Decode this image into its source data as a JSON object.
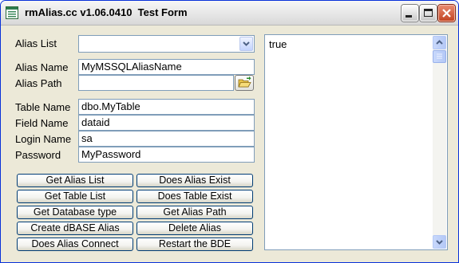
{
  "window": {
    "title": "rmAlias.cc v1.06.0410  Test Form"
  },
  "fields": {
    "alias_list": {
      "label": "Alias List",
      "value": ""
    },
    "alias_name": {
      "label": "Alias Name",
      "value": "MyMSSQLAliasName"
    },
    "alias_path": {
      "label": "Alias Path",
      "value": ""
    },
    "table_name": {
      "label": "Table Name",
      "value": "dbo.MyTable"
    },
    "field_name": {
      "label": "Field Name",
      "value": "dataid"
    },
    "login_name": {
      "label": "Login Name",
      "value": "sa"
    },
    "password": {
      "label": "Password",
      "value": "MyPassword"
    }
  },
  "buttons": {
    "get_alias_list": "Get Alias List",
    "does_alias_exist": "Does Alias Exist",
    "get_table_list": "Get Table List",
    "does_table_exist": "Does Table Exist",
    "get_database_type": "Get Database type",
    "get_alias_path": "Get Alias Path",
    "create_dbase_alias": "Create dBASE Alias",
    "delete_alias": "Delete Alias",
    "does_alias_connect": "Does Alias Connect",
    "restart_bde": "Restart the BDE"
  },
  "output": {
    "text": "true"
  },
  "icons": {
    "app": "form-icon",
    "minimize": "minimize-icon",
    "maximize": "maximize-icon",
    "close": "close-icon",
    "dropdown": "chevron-down-icon",
    "browse": "open-folder-icon"
  }
}
